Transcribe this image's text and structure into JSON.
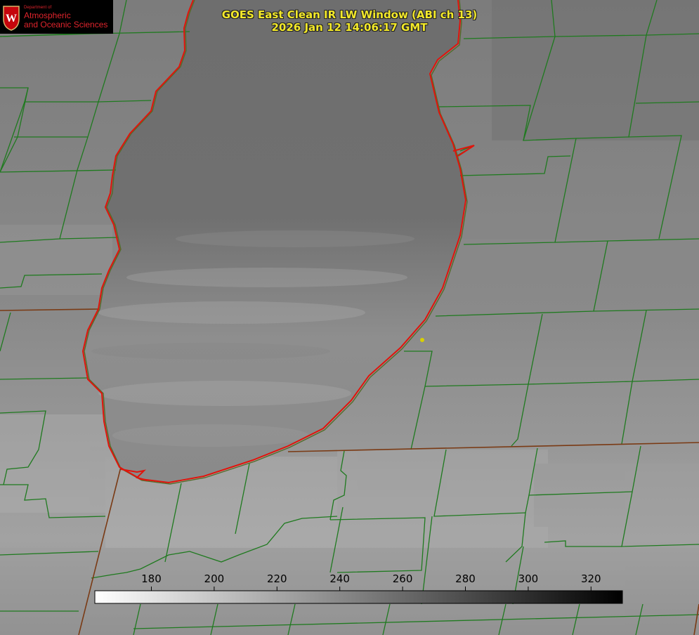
{
  "title": {
    "line1": "GOES East Clean IR LW Window (ABI ch 13)",
    "line2": "2026 Jan 12 14:06:17 GMT"
  },
  "logo": {
    "line0": "Department of",
    "line1": "Atmospheric",
    "line2": "and Oceanic Sciences",
    "seal_letter": "W"
  },
  "colorbar": {
    "min": 162,
    "max": 330,
    "ticks": [
      "180",
      "200",
      "220",
      "240",
      "260",
      "280",
      "300",
      "320"
    ],
    "start_color": "#ffffff",
    "end_color": "#000000"
  },
  "colors": {
    "county_lines": "#1f7a1f",
    "coastline": "#e0140c",
    "state_lines": "#7a3a14",
    "title_text": "#f2e82a",
    "logo_text": "#e0242c",
    "marker": "#d8d000"
  },
  "map": {
    "feature": "lake",
    "marker": "yellow-dot"
  }
}
